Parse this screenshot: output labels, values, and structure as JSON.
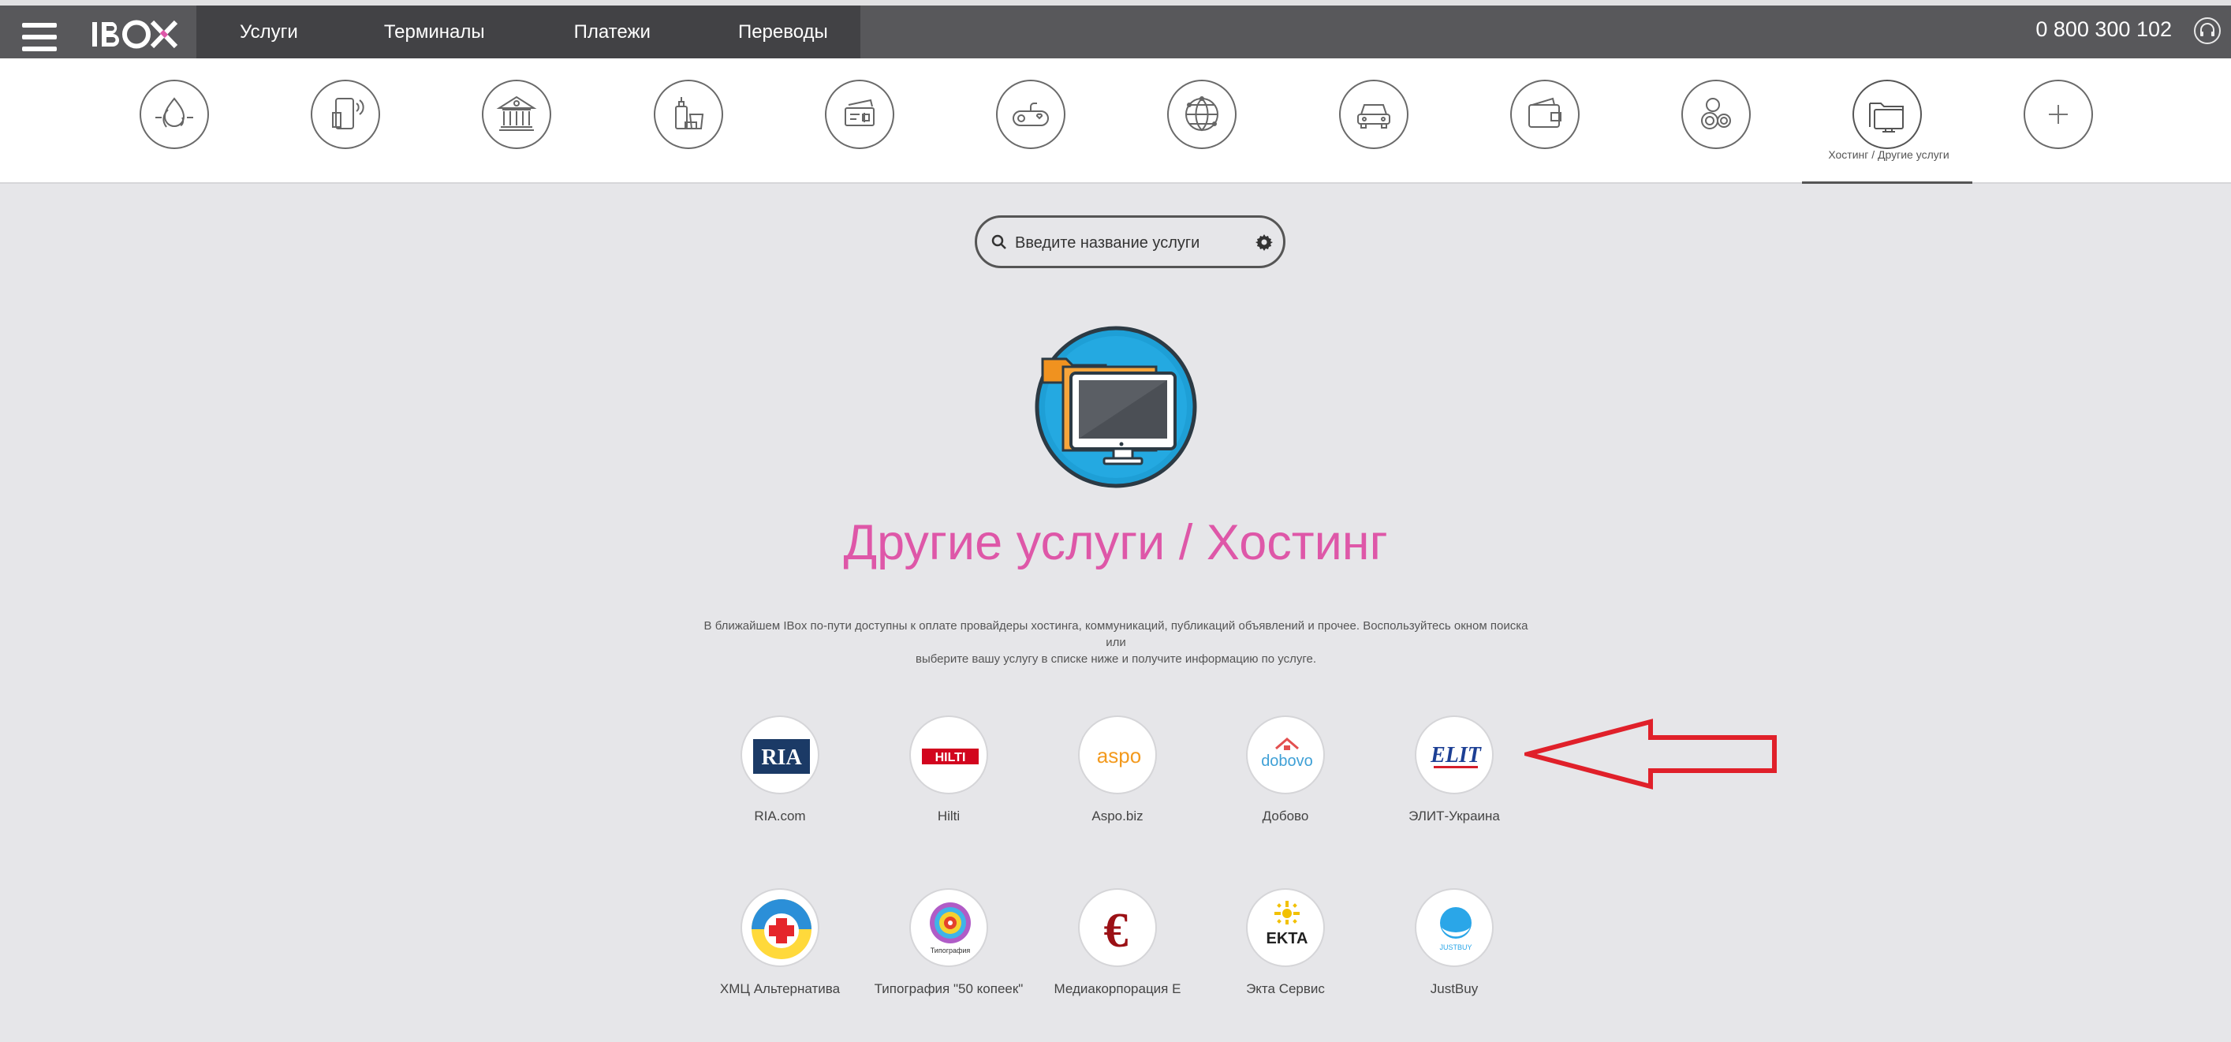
{
  "topbar": {
    "nav": [
      "Услуги",
      "Терминалы",
      "Платежи",
      "Переводы"
    ],
    "phone": "0 800 300 102"
  },
  "categories": [
    {
      "icon": "utilities-icon"
    },
    {
      "icon": "mobile-icon"
    },
    {
      "icon": "bank-icon"
    },
    {
      "icon": "cosmetics-icon"
    },
    {
      "icon": "tickets-icon"
    },
    {
      "icon": "games-icon"
    },
    {
      "icon": "internet-icon"
    },
    {
      "icon": "car-icon"
    },
    {
      "icon": "wallet-icon"
    },
    {
      "icon": "coins-icon"
    },
    {
      "icon": "folder-monitor-icon",
      "label": "Хостинг / Другие услуги",
      "active": true
    },
    {
      "icon": "plus-icon"
    }
  ],
  "search": {
    "placeholder": "Введите название услуги"
  },
  "page": {
    "title": "Другие услуги / Хостинг",
    "description_line1": "В ближайшем IBox по-пути доступны к оплате провайдеры хостинга, коммуникаций, публикаций объявлений и прочее. Воспользуйтесь окном поиска или",
    "description_line2": "выберите вашу услугу в списке ниже и получите информацию по услуге."
  },
  "providers": [
    {
      "name": "RIA.com",
      "logo_text": "RIA"
    },
    {
      "name": "Hilti",
      "logo_text": "HILTI"
    },
    {
      "name": "Aspo.biz",
      "logo_text": "aspo"
    },
    {
      "name": "Добово",
      "logo_text": "dobovo"
    },
    {
      "name": "ЭЛИТ-Украина",
      "logo_text": "ELIT"
    },
    {
      "name": "ХМЦ Альтернатива"
    },
    {
      "name": "Типография \"50 копеек\"",
      "logo_text": "Типография"
    },
    {
      "name": "Медиакорпорация Е",
      "logo_text": "€"
    },
    {
      "name": "Экта Сервис",
      "logo_text": "EKTA"
    },
    {
      "name": "JustBuy",
      "logo_text": "JUSTBUY"
    }
  ],
  "colors": {
    "brand_pink": "#de57a8",
    "header_dark": "#58585b",
    "nav_dark": "#424245",
    "arrow_red": "#e0202a"
  }
}
